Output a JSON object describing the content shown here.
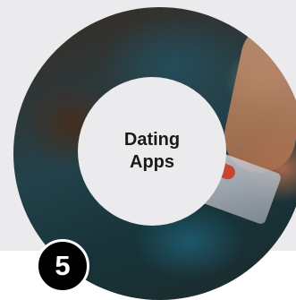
{
  "card": {
    "title": "Dating\nApps",
    "number": "5"
  },
  "image": {
    "description_icon": "hand-holding-phone-photo"
  },
  "colors": {
    "panel_background": "#ebebed",
    "badge_background": "#000000",
    "badge_text": "#ffffff",
    "title_text": "#1a1a1a"
  }
}
